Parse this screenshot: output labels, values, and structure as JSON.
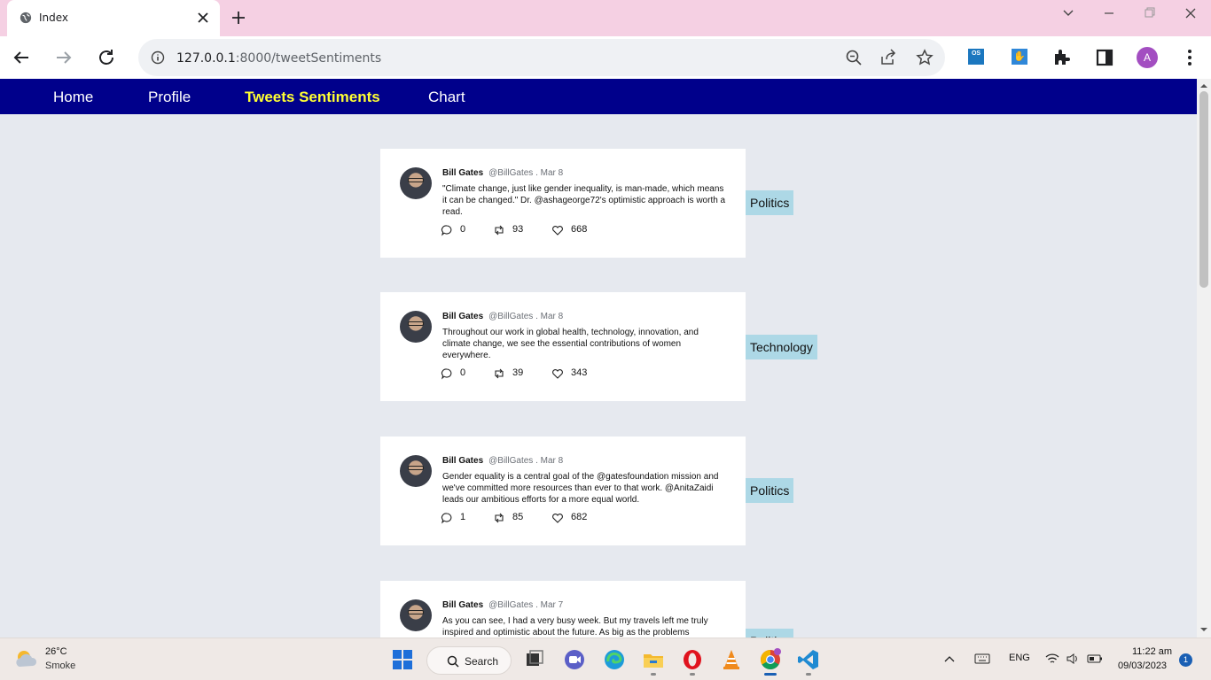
{
  "browser": {
    "tab_title": "Index",
    "url_host": "127.0.0.1",
    "url_rest": ":8000/tweetSentiments",
    "profile_initial": "A",
    "ext_os_label": "OS"
  },
  "nav": {
    "items": [
      {
        "label": "Home",
        "active": false
      },
      {
        "label": "Profile",
        "active": false
      },
      {
        "label": "Tweets Sentiments",
        "active": true
      },
      {
        "label": "Chart",
        "active": false
      }
    ]
  },
  "tweets": [
    {
      "name": "Bill Gates",
      "handle_date": "@BillGates . Mar 8",
      "text": "\"Climate change, just like gender inequality, is man-made, which means it can be changed.\" Dr. @ashageorge72's optimistic approach is worth a read.",
      "replies": "0",
      "retweets": "93",
      "likes": "668",
      "category": "Politics"
    },
    {
      "name": "Bill Gates",
      "handle_date": "@BillGates . Mar 8",
      "text": "Throughout our work in global health, technology, innovation, and climate change, we see the essential contributions of women everywhere.",
      "replies": "0",
      "retweets": "39",
      "likes": "343",
      "category": "Technology"
    },
    {
      "name": "Bill Gates",
      "handle_date": "@BillGates . Mar 8",
      "text": "Gender equality is a central goal of the @gatesfoundation mission and we've committed more resources than ever to that work. @AnitaZaidi leads our ambitious efforts for a more equal world.",
      "replies": "1",
      "retweets": "85",
      "likes": "682",
      "category": "Politics"
    },
    {
      "name": "Bill Gates",
      "handle_date": "@BillGates . Mar 7",
      "text": "As you can see, I had a very busy week. But my travels left me truly inspired and optimistic about the future. As big as the problems",
      "replies": "",
      "retweets": "",
      "likes": "",
      "category": "Politics"
    }
  ],
  "taskbar": {
    "weather_temp": "26°C",
    "weather_desc": "Smoke",
    "search_label": "Search",
    "lang": "ENG",
    "time": "11:22 am",
    "date": "09/03/2023",
    "notification_count": "1"
  },
  "colors": {
    "navbar": "#00008b",
    "active_nav": "#ffff33",
    "badge": "#add8e6",
    "page_bg": "#e6e9ef",
    "tab_strip": "#f5d0e3"
  }
}
